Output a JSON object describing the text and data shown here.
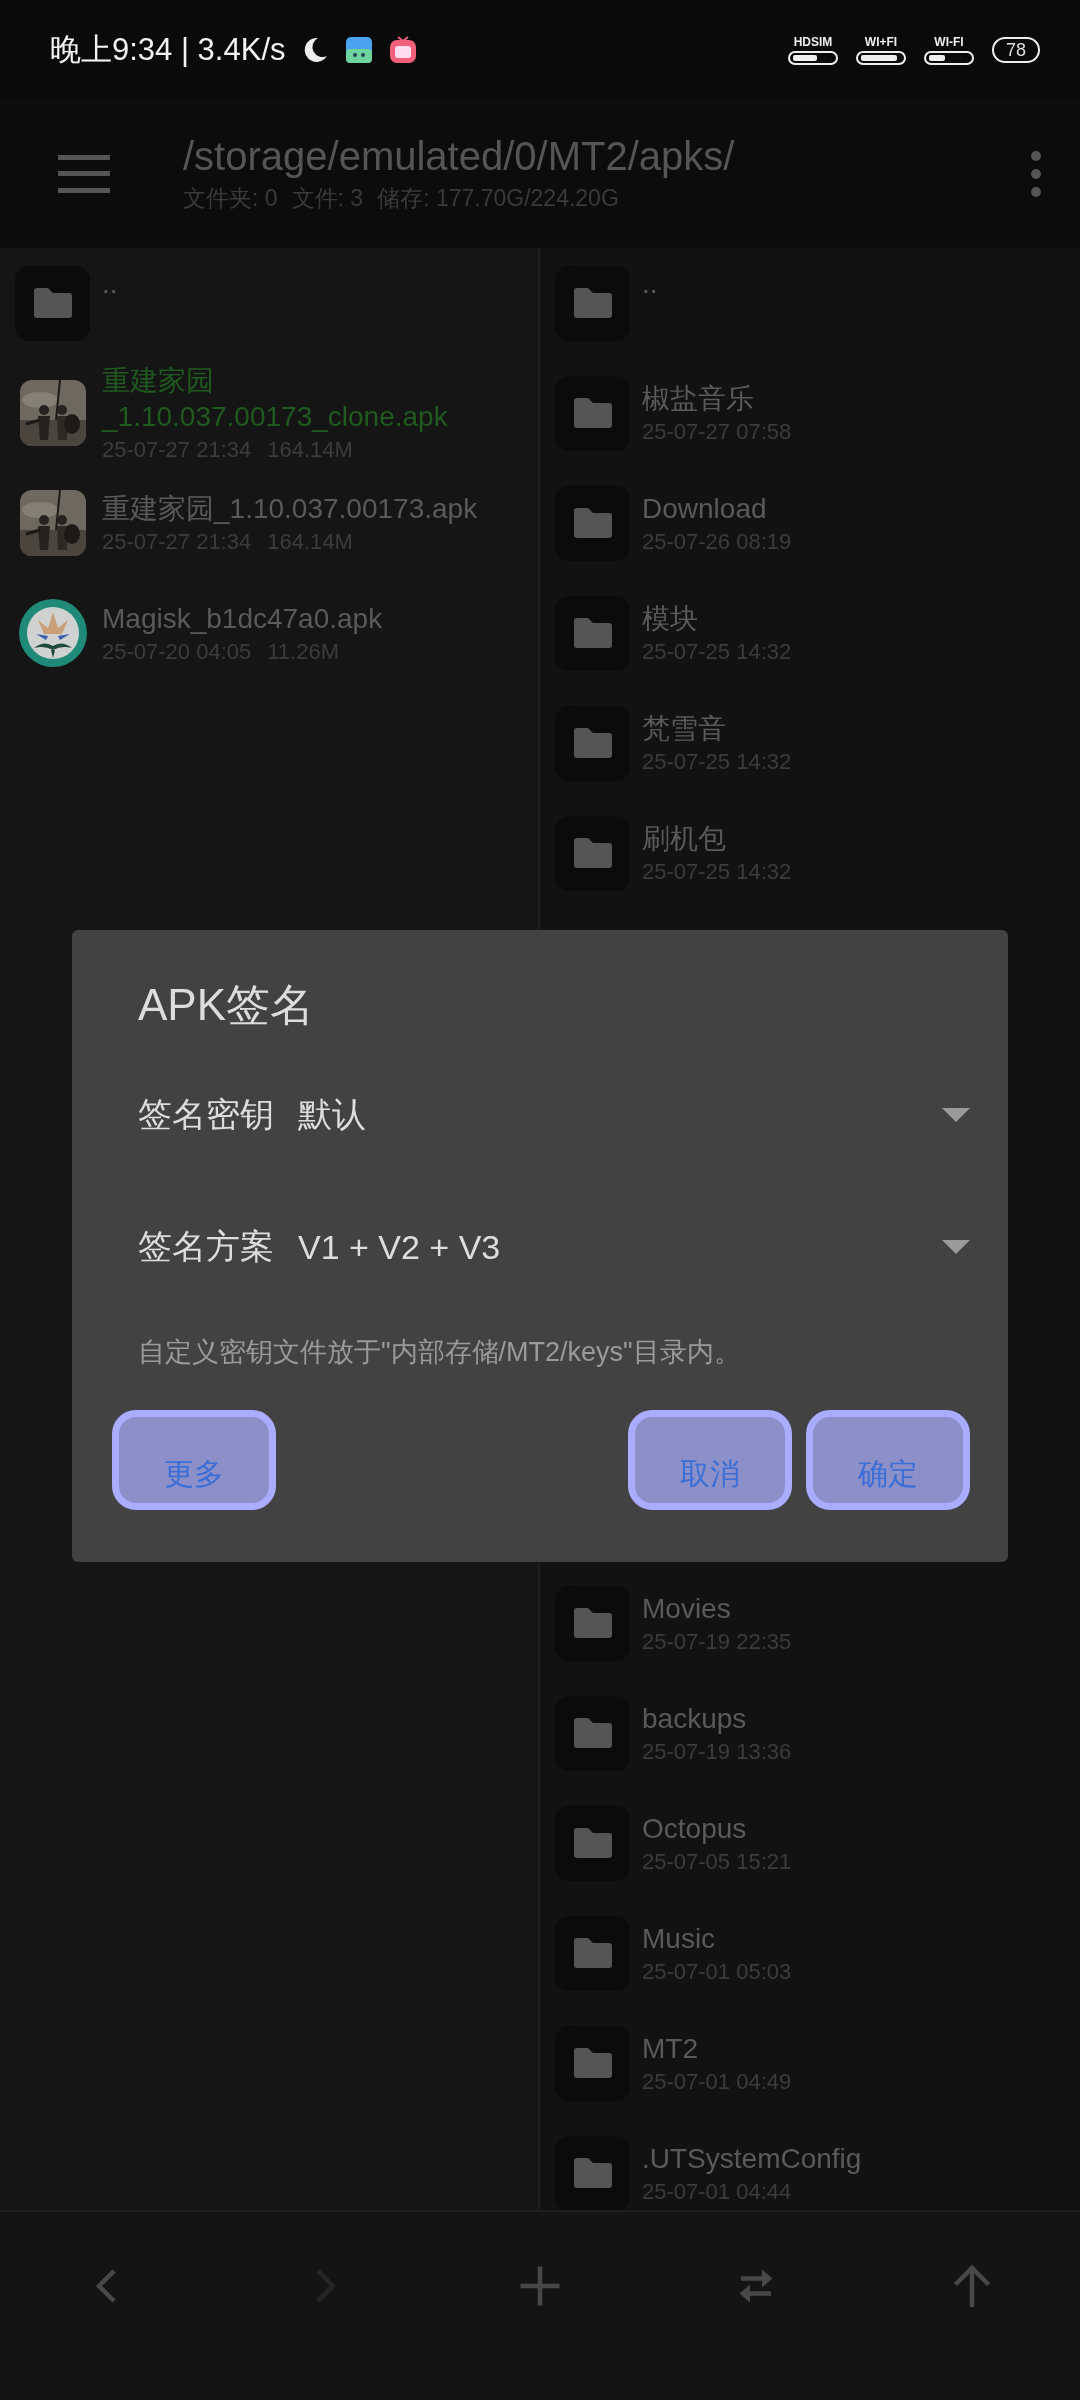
{
  "status_bar": {
    "time": "晚上9:34 | 3.4K/s",
    "signals": [
      {
        "label": "HDSIM"
      },
      {
        "label": "WI+FI"
      },
      {
        "label": "WI-FI"
      }
    ],
    "battery": "78"
  },
  "header": {
    "path": "/storage/emulated/0/MT2/apks/",
    "stats": [
      "文件夹: 0",
      "文件: 3",
      "储存: 177.70G/224.20G"
    ]
  },
  "left_pane": {
    "items": [
      {
        "kind": "up",
        "name": ".."
      },
      {
        "kind": "apk_picture",
        "name": "重建家园_1.10.037.00173_clone.apk",
        "date": "25-07-27 21:34",
        "size": "164.14M",
        "highlighted": true
      },
      {
        "kind": "apk_picture",
        "name": "重建家园_1.10.037.00173.apk",
        "date": "25-07-27 21:34",
        "size": "164.14M",
        "highlighted": false
      },
      {
        "kind": "apk_round",
        "name": "Magisk_b1dc47a0.apk",
        "date": "25-07-20 04:05",
        "size": "11.26M",
        "highlighted": false
      }
    ]
  },
  "right_pane": {
    "items_top": [
      {
        "kind": "up",
        "name": ".."
      },
      {
        "kind": "folder",
        "name": "椒盐音乐",
        "date": "25-07-27 07:58"
      },
      {
        "kind": "folder",
        "name": "Download",
        "date": "25-07-26 08:19"
      },
      {
        "kind": "folder",
        "name": "模块",
        "date": "25-07-25 14:32"
      },
      {
        "kind": "folder",
        "name": "梵雪音",
        "date": "25-07-25 14:32"
      },
      {
        "kind": "folder",
        "name": "刷机包",
        "date": "25-07-25 14:32"
      }
    ],
    "items_bottom": [
      {
        "kind": "folder",
        "name": "Movies",
        "date": "25-07-19 22:35"
      },
      {
        "kind": "folder",
        "name": "backups",
        "date": "25-07-19 13:36"
      },
      {
        "kind": "folder",
        "name": "Octopus",
        "date": "25-07-05 15:21"
      },
      {
        "kind": "folder",
        "name": "Music",
        "date": "25-07-01 05:03"
      },
      {
        "kind": "folder",
        "name": "MT2",
        "date": "25-07-01 04:49"
      },
      {
        "kind": "folder",
        "name": ".UTSystemConfig",
        "date": "25-07-01 04:44"
      }
    ]
  },
  "dialog": {
    "title": "APK签名",
    "fields": [
      {
        "label": "签名密钥",
        "value": "默认"
      },
      {
        "label": "签名方案",
        "value": "V1 + V2 + V3"
      }
    ],
    "hint": "自定义密钥文件放于\"内部存储/MT2/keys\"目录内。",
    "buttons_left": [
      "更多"
    ],
    "buttons_right": [
      "取消",
      "确定"
    ]
  },
  "toolbar": [
    {
      "kind": "back",
      "disabled": false
    },
    {
      "kind": "forward",
      "disabled": true
    },
    {
      "kind": "add",
      "disabled": false
    },
    {
      "kind": "swap",
      "disabled": false
    },
    {
      "kind": "up",
      "disabled": false
    }
  ]
}
